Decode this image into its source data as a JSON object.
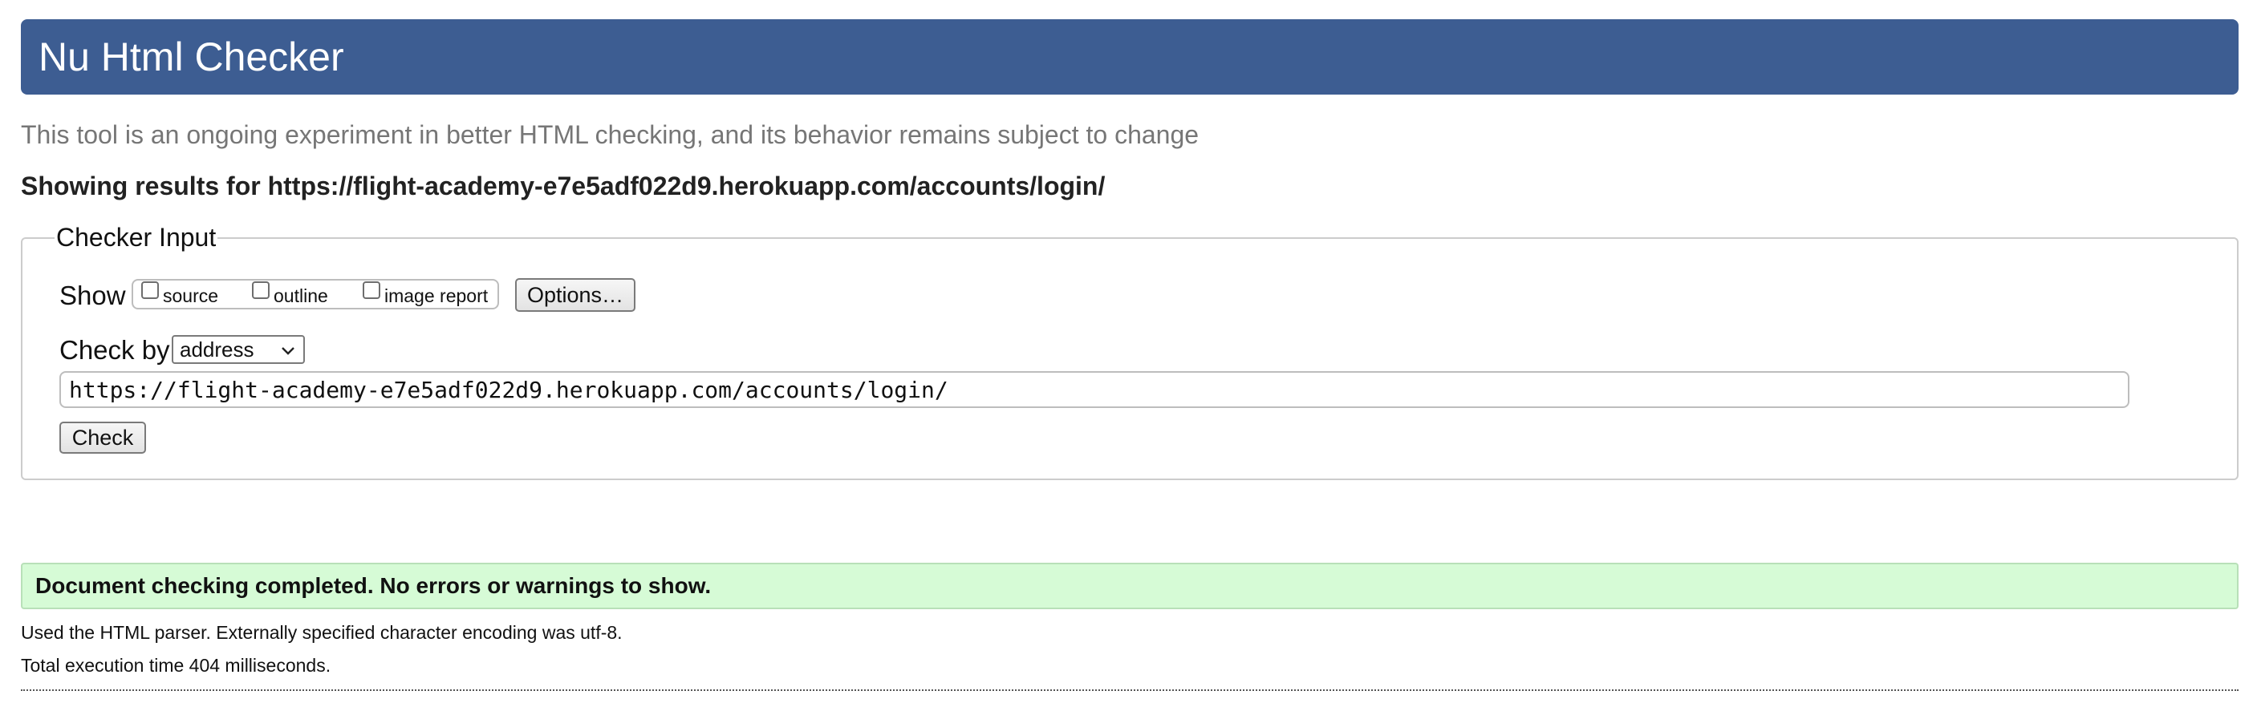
{
  "header": {
    "title": "Nu Html Checker",
    "background_color": "#3d5d92"
  },
  "tagline": "This tool is an ongoing experiment in better HTML checking, and its behavior remains subject to change",
  "results_for": "Showing results for https://flight-academy-e7e5adf022d9.herokuapp.com/accounts/login/",
  "checker_input": {
    "legend": "Checker Input",
    "show_label": "Show",
    "show_options": [
      {
        "label": "source",
        "checked": false
      },
      {
        "label": "outline",
        "checked": false
      },
      {
        "label": "image report",
        "checked": false
      }
    ],
    "options_button": "Options…",
    "check_by_label": "Check by",
    "check_by_selected": "address",
    "url_value": "https://flight-academy-e7e5adf022d9.herokuapp.com/accounts/login/",
    "check_button": "Check",
    "select_icon": "chevron-down-icon"
  },
  "result": {
    "message": "Document checking completed. No errors or warnings to show.",
    "background_color": "#d6fbd6"
  },
  "info": {
    "parser": "Used the HTML parser. Externally specified character encoding was utf-8.",
    "execution_time": "Total execution time 404 milliseconds."
  }
}
